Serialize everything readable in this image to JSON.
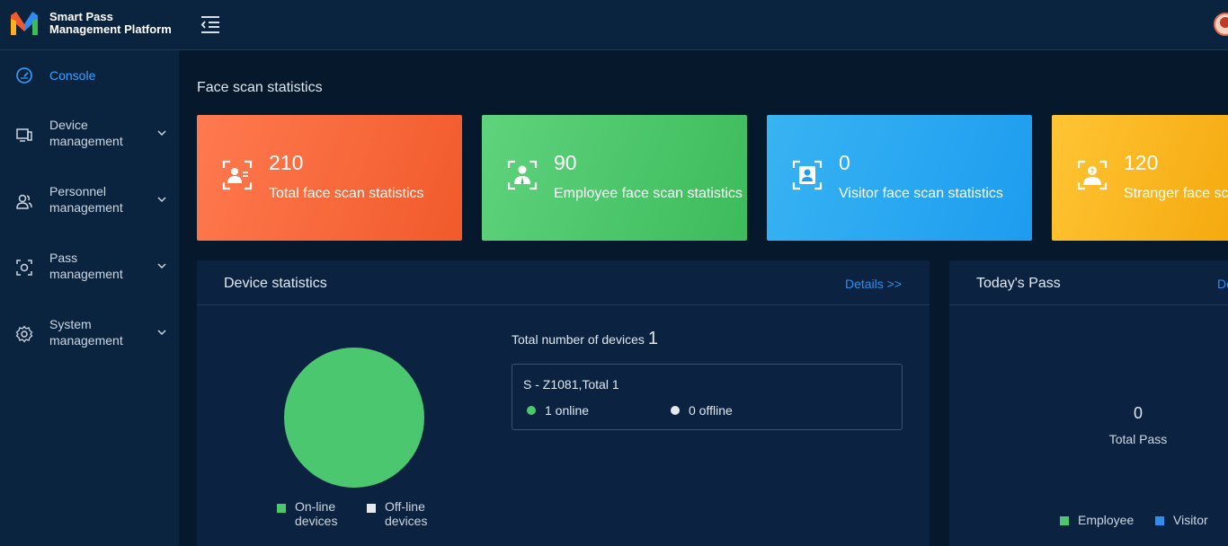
{
  "app": {
    "title_line1": "Smart Pass",
    "title_line2": "Management Platform"
  },
  "sidebar": {
    "items": [
      {
        "label": "Console",
        "icon": "dashboard-icon",
        "active": true
      },
      {
        "label": "Device\nmanagement",
        "icon": "device-icon"
      },
      {
        "label": "Personnel\nmanagement",
        "icon": "users-icon"
      },
      {
        "label": "Pass\nmanagement",
        "icon": "pass-icon"
      },
      {
        "label": "System\nmanagement",
        "icon": "gear-icon"
      }
    ]
  },
  "face_scan": {
    "title": "Face scan statistics",
    "cards": [
      {
        "value": "210",
        "label": "Total face scan statistics",
        "color": "#f15a2b"
      },
      {
        "value": "90",
        "label": "Employee face scan statistics",
        "color": "#3dbb5b"
      },
      {
        "value": "0",
        "label": "Visitor face scan statistics",
        "color": "#1d9cf0"
      },
      {
        "value": "120",
        "label": "Stranger face scan statistics",
        "color": "#f5a90f"
      }
    ]
  },
  "device_stats": {
    "title": "Device statistics",
    "details_link": "Details >>",
    "total_label": "Total number of devices",
    "total_value": "1",
    "device_name": "S - Z1081,Total 1",
    "online_text": "1 online",
    "offline_text": "0 offline",
    "legend_online": "On-line\ndevices",
    "legend_offline": "Off-line\ndevices",
    "online_color": "#4bc86f",
    "offline_color": "#e6e9ee"
  },
  "todays_pass": {
    "title": "Today's Pass",
    "details_link": "Details >>",
    "total_value": "0",
    "total_label": "Total Pass",
    "legend_employee": "Employee",
    "legend_visitor": "Visitor",
    "employee_color": "#4bc86f",
    "visitor_color": "#2f8cf0"
  },
  "chart_data": {
    "type": "pie",
    "categories": [
      "On-line devices",
      "Off-line devices"
    ],
    "values": [
      1,
      0
    ]
  }
}
